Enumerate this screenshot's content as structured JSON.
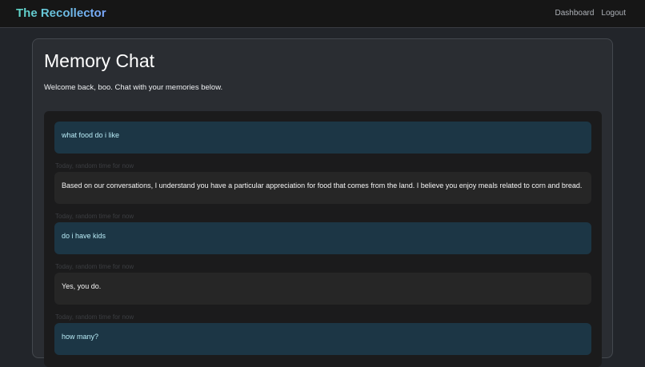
{
  "header": {
    "brand": "The Recollector",
    "nav": {
      "dashboard": "Dashboard",
      "logout": "Logout"
    }
  },
  "page": {
    "title": "Memory Chat",
    "welcome": "Welcome back, boo. Chat with your memories below."
  },
  "chat": {
    "messages": [
      {
        "role": "user",
        "text": "what food do i like",
        "time": "Today, random time for now"
      },
      {
        "role": "bot",
        "text": "Based on our conversations, I understand you have a particular appreciation for food that comes from the land. I believe you enjoy meals related to corn and bread.",
        "time": "Today, random time for now"
      },
      {
        "role": "user",
        "text": "do i have kids",
        "time": "Today, random time for now"
      },
      {
        "role": "bot",
        "text": "Yes, you do.",
        "time": "Today, random time for now"
      },
      {
        "role": "user",
        "text": "how many?",
        "time": ""
      }
    ]
  },
  "colors": {
    "user_bubble": "#1c3645",
    "bot_bubble": "#262626",
    "accent": "#5fd6c6"
  }
}
